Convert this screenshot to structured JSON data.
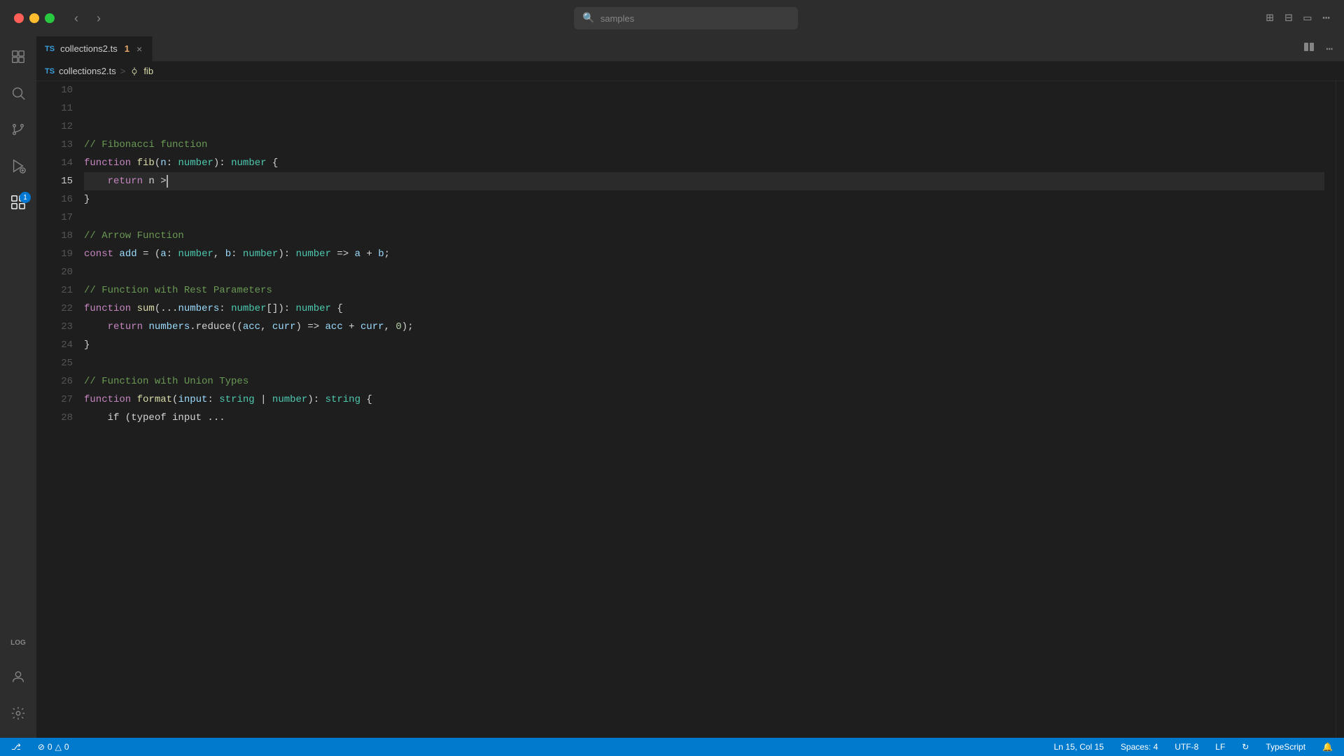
{
  "titlebar": {
    "back_btn": "‹",
    "forward_btn": "›",
    "search_placeholder": "samples",
    "layout_icons": [
      "⊞",
      "⊟",
      "▭",
      "⊞"
    ]
  },
  "tab": {
    "ts_icon": "TS",
    "filename": "collections2.ts",
    "modified_indicator": "1",
    "close_label": "×"
  },
  "breadcrumb": {
    "file": "collections2.ts",
    "separator": ">",
    "symbol": "fib"
  },
  "activity": {
    "items": [
      {
        "icon": "⧉",
        "name": "explorer",
        "active": false
      },
      {
        "icon": "🔍",
        "name": "search",
        "active": false
      },
      {
        "icon": "⎇",
        "name": "source-control",
        "active": false
      },
      {
        "icon": "▷",
        "name": "run-debug",
        "active": false
      },
      {
        "icon": "⊞",
        "name": "extensions",
        "active": true,
        "badge": "1"
      }
    ],
    "bottom": [
      {
        "icon": "👤",
        "name": "account"
      },
      {
        "icon": "⚙",
        "name": "settings"
      }
    ],
    "log_label": "LOG"
  },
  "code": {
    "lines": [
      {
        "num": 10,
        "content": [],
        "active": false
      },
      {
        "num": 11,
        "content": [],
        "active": false
      },
      {
        "num": 12,
        "content": [],
        "active": false
      },
      {
        "num": 13,
        "content": [
          {
            "text": "// Fibonacci function",
            "class": "comment"
          }
        ],
        "active": false
      },
      {
        "num": 14,
        "content": [
          {
            "text": "function",
            "class": "kw"
          },
          {
            "text": " ",
            "class": "plain"
          },
          {
            "text": "fib",
            "class": "fn"
          },
          {
            "text": "(",
            "class": "punc"
          },
          {
            "text": "n",
            "class": "param"
          },
          {
            "text": ": ",
            "class": "punc"
          },
          {
            "text": "number",
            "class": "type"
          },
          {
            "text": "): ",
            "class": "punc"
          },
          {
            "text": "number",
            "class": "type"
          },
          {
            "text": " {",
            "class": "punc"
          }
        ],
        "active": false
      },
      {
        "num": 15,
        "content": [
          {
            "text": "    ",
            "class": "plain"
          },
          {
            "text": "return",
            "class": "kw"
          },
          {
            "text": " n >",
            "class": "plain"
          },
          {
            "text": "CURSOR",
            "class": "cursor"
          }
        ],
        "active": true,
        "highlighted": true
      },
      {
        "num": 16,
        "content": [
          {
            "text": "}",
            "class": "punc"
          }
        ],
        "active": false
      },
      {
        "num": 17,
        "content": [],
        "active": false
      },
      {
        "num": 18,
        "content": [
          {
            "text": "// Arrow Function",
            "class": "comment"
          }
        ],
        "active": false
      },
      {
        "num": 19,
        "content": [
          {
            "text": "const",
            "class": "kw"
          },
          {
            "text": " ",
            "class": "plain"
          },
          {
            "text": "add",
            "class": "var"
          },
          {
            "text": " = (",
            "class": "punc"
          },
          {
            "text": "a",
            "class": "param"
          },
          {
            "text": ": ",
            "class": "punc"
          },
          {
            "text": "number",
            "class": "type"
          },
          {
            "text": ", ",
            "class": "punc"
          },
          {
            "text": "b",
            "class": "param"
          },
          {
            "text": ": ",
            "class": "punc"
          },
          {
            "text": "number",
            "class": "type"
          },
          {
            "text": "): ",
            "class": "punc"
          },
          {
            "text": "number",
            "class": "type"
          },
          {
            "text": " => ",
            "class": "op"
          },
          {
            "text": "a",
            "class": "var"
          },
          {
            "text": " + ",
            "class": "op"
          },
          {
            "text": "b",
            "class": "var"
          },
          {
            "text": ";",
            "class": "punc"
          }
        ],
        "active": false
      },
      {
        "num": 20,
        "content": [],
        "active": false
      },
      {
        "num": 21,
        "content": [
          {
            "text": "// Function with Rest Parameters",
            "class": "comment"
          }
        ],
        "active": false
      },
      {
        "num": 22,
        "content": [
          {
            "text": "function",
            "class": "kw"
          },
          {
            "text": " ",
            "class": "plain"
          },
          {
            "text": "sum",
            "class": "fn"
          },
          {
            "text": "(...",
            "class": "punc"
          },
          {
            "text": "numbers",
            "class": "param"
          },
          {
            "text": ": ",
            "class": "punc"
          },
          {
            "text": "number",
            "class": "type"
          },
          {
            "text": "[]",
            "class": "punc"
          },
          {
            "text": "): ",
            "class": "punc"
          },
          {
            "text": "number",
            "class": "type"
          },
          {
            "text": " {",
            "class": "punc"
          }
        ],
        "active": false
      },
      {
        "num": 23,
        "content": [
          {
            "text": "    ",
            "class": "plain"
          },
          {
            "text": "return",
            "class": "kw"
          },
          {
            "text": " ",
            "class": "plain"
          },
          {
            "text": "numbers",
            "class": "var"
          },
          {
            "text": ".reduce((",
            "class": "punc"
          },
          {
            "text": "acc",
            "class": "param"
          },
          {
            "text": ", ",
            "class": "punc"
          },
          {
            "text": "curr",
            "class": "param"
          },
          {
            "text": ") => ",
            "class": "op"
          },
          {
            "text": "acc",
            "class": "var"
          },
          {
            "text": " + ",
            "class": "op"
          },
          {
            "text": "curr",
            "class": "var"
          },
          {
            "text": ", ",
            "class": "punc"
          },
          {
            "text": "0",
            "class": "num"
          },
          {
            "text": ");",
            "class": "punc"
          }
        ],
        "active": false
      },
      {
        "num": 24,
        "content": [
          {
            "text": "}",
            "class": "punc"
          }
        ],
        "active": false
      },
      {
        "num": 25,
        "content": [],
        "active": false
      },
      {
        "num": 26,
        "content": [
          {
            "text": "// Function with Union Types",
            "class": "comment"
          }
        ],
        "active": false
      },
      {
        "num": 27,
        "content": [
          {
            "text": "function",
            "class": "kw"
          },
          {
            "text": " ",
            "class": "plain"
          },
          {
            "text": "format",
            "class": "fn"
          },
          {
            "text": "(",
            "class": "punc"
          },
          {
            "text": "input",
            "class": "param"
          },
          {
            "text": ": ",
            "class": "punc"
          },
          {
            "text": "string",
            "class": "type"
          },
          {
            "text": " | ",
            "class": "op"
          },
          {
            "text": "number",
            "class": "type"
          },
          {
            "text": "): ",
            "class": "punc"
          },
          {
            "text": "string",
            "class": "type"
          },
          {
            "text": " {",
            "class": "punc"
          }
        ],
        "active": false
      },
      {
        "num": 28,
        "content": [
          {
            "text": "    if (typeof input ...",
            "class": "plain"
          }
        ],
        "active": false
      }
    ]
  },
  "status_bar": {
    "branch_icon": "⎇",
    "branch": "",
    "errors": "0",
    "warnings": "0",
    "error_icon": "⊘",
    "warning_icon": "△",
    "position": "Ln 15, Col 15",
    "spaces": "Spaces: 4",
    "encoding": "UTF-8",
    "line_ending": "LF",
    "language": "TypeScript",
    "sync_icon": "↻",
    "bell_icon": "🔔",
    "notification_icon": "🔔"
  }
}
